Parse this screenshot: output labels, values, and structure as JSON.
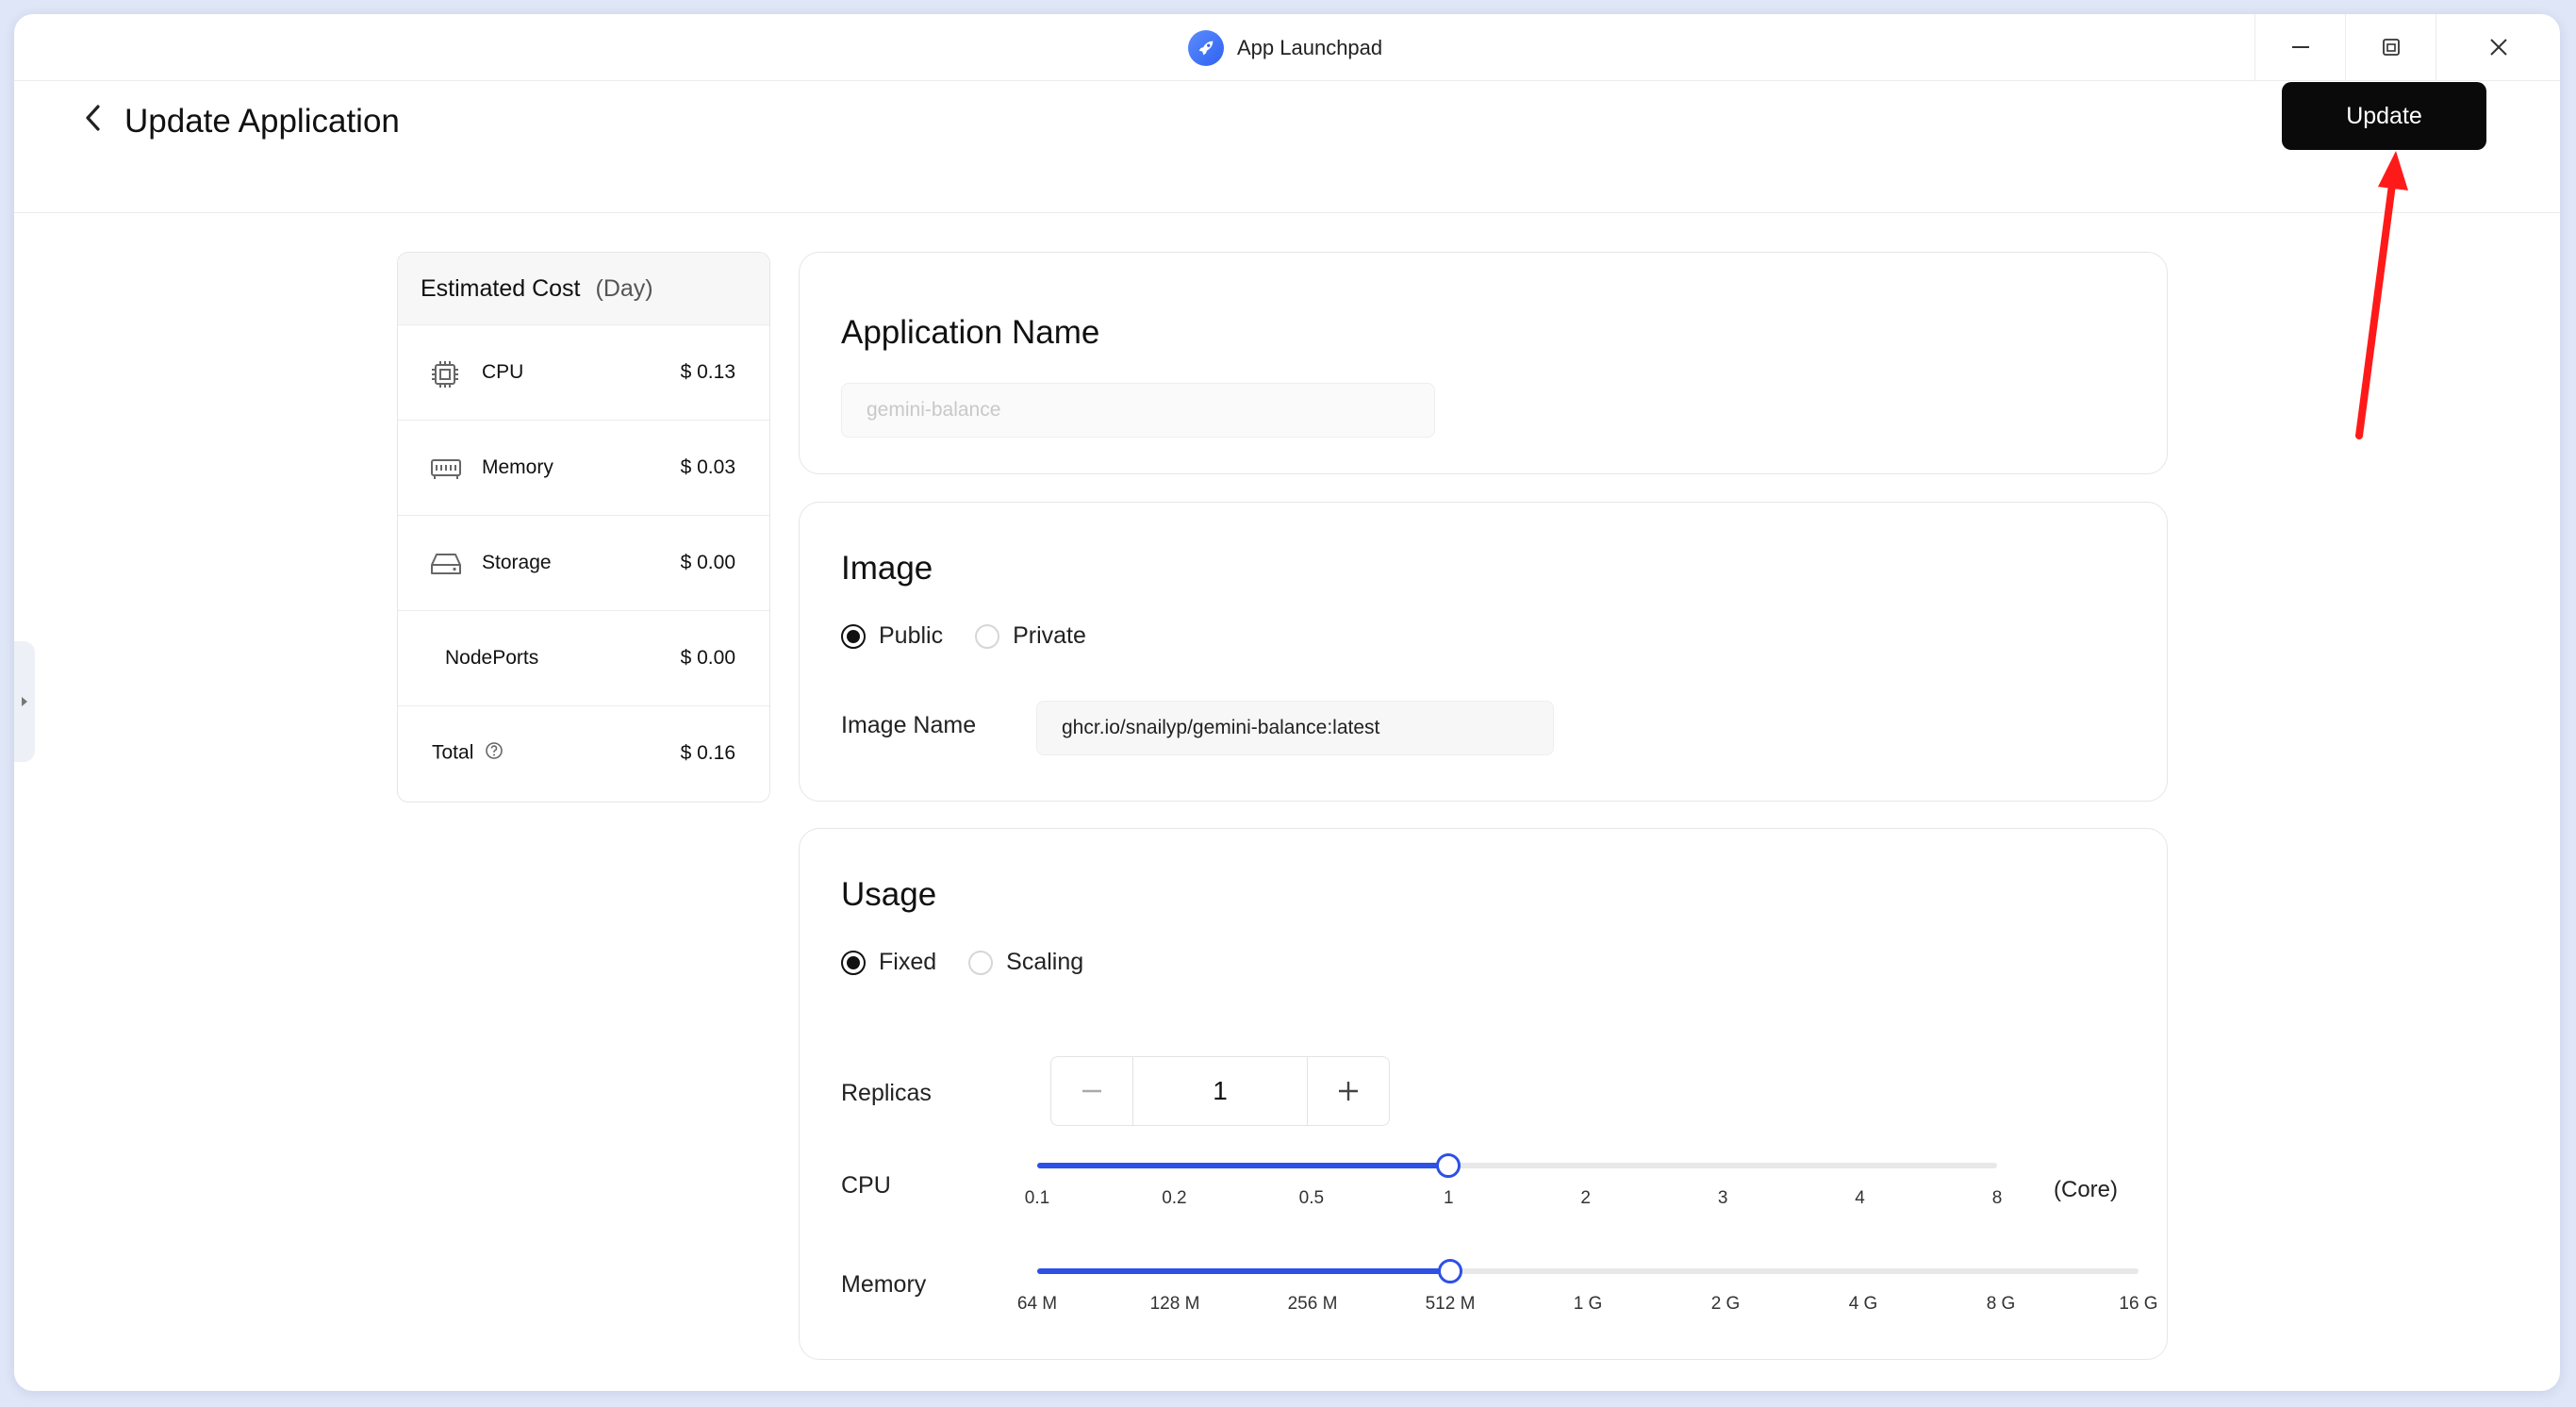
{
  "window": {
    "title": "App Launchpad",
    "controls": [
      "minimize",
      "restore",
      "close"
    ]
  },
  "header": {
    "title": "Update Application",
    "update_label": "Update"
  },
  "cost": {
    "title": "Estimated Cost",
    "period": "(Day)",
    "rows": [
      {
        "icon": "cpu-icon",
        "label": "CPU",
        "price": "$ 0.13"
      },
      {
        "icon": "memory-icon",
        "label": "Memory",
        "price": "$ 0.03"
      },
      {
        "icon": "storage-icon",
        "label": "Storage",
        "price": "$ 0.00"
      },
      {
        "icon": "",
        "label": "NodePorts",
        "price": "$ 0.00"
      },
      {
        "icon": "help-icon",
        "label": "Total",
        "price": "$ 0.16"
      }
    ]
  },
  "app_name": {
    "title": "Application Name",
    "value": "gemini-balance"
  },
  "image": {
    "title": "Image",
    "options": [
      "Public",
      "Private"
    ],
    "selected": "Public",
    "name_label": "Image Name",
    "name_value": "ghcr.io/snailyp/gemini-balance:latest"
  },
  "usage": {
    "title": "Usage",
    "modes": [
      "Fixed",
      "Scaling"
    ],
    "selected_mode": "Fixed",
    "replicas_label": "Replicas",
    "replicas_value": "1",
    "cpu": {
      "label": "CPU",
      "ticks": [
        "0.1",
        "0.2",
        "0.5",
        "1",
        "2",
        "3",
        "4",
        "8"
      ],
      "selected": "1",
      "unit": "(Core)"
    },
    "memory": {
      "label": "Memory",
      "ticks": [
        "64 M",
        "128 M",
        "256 M",
        "512 M",
        "1 G",
        "2 G",
        "4 G",
        "8 G",
        "16 G"
      ],
      "selected": "512 M"
    }
  },
  "colors": {
    "accent": "#2d50e6",
    "primary_button": "#0a0a0a",
    "annotation_arrow": "#ff1a1a"
  }
}
